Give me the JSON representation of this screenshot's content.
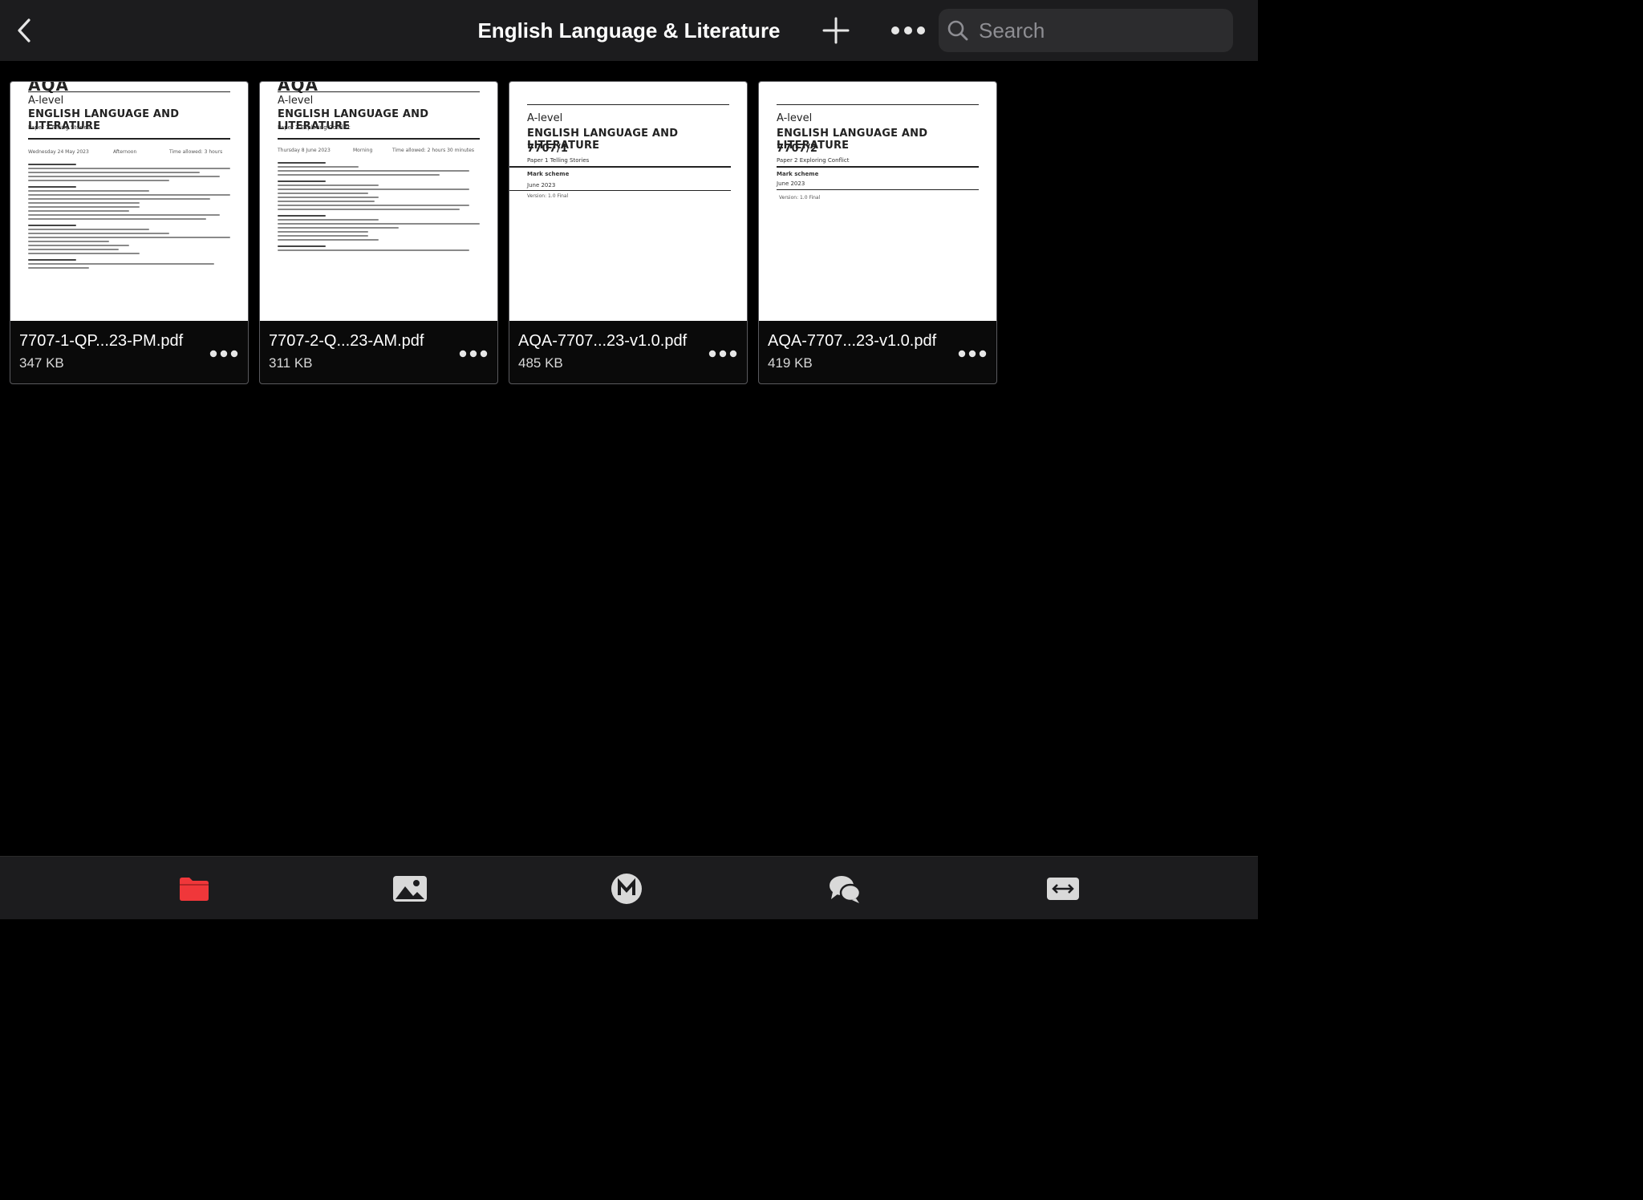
{
  "header": {
    "title": "English Language & Literature",
    "back_icon": "chevron-left-icon",
    "add_icon": "plus-icon",
    "more_icon": "ellipsis-icon",
    "search": {
      "placeholder": "Search",
      "value": "",
      "icon": "search-icon"
    }
  },
  "files": [
    {
      "name": "7707-1-QP...23-PM.pdf",
      "size": "347 KB",
      "thumb": {
        "logo": "AQA",
        "level": "A-level",
        "subject": "ENGLISH LANGUAGE AND LITERATURE",
        "paper": "Paper 1  Telling Stories",
        "date": "Wednesday 24 May 2023",
        "session": "Afternoon",
        "time": "Time allowed: 3 hours"
      }
    },
    {
      "name": "7707-2-Q...23-AM.pdf",
      "size": "311 KB",
      "thumb": {
        "logo": "AQA",
        "level": "A-level",
        "subject": "ENGLISH LANGUAGE AND LITERATURE",
        "paper": "Paper 2  Exploring Conflict",
        "date": "Thursday 8 June 2023",
        "session": "Morning",
        "time": "Time allowed: 2 hours 30 minutes"
      }
    },
    {
      "name": "AQA-7707...23-v1.0.pdf",
      "size": "485 KB",
      "thumb": {
        "level": "A-level",
        "subject": "ENGLISH LANGUAGE AND LITERATURE",
        "code": "7707/1",
        "paper": "Paper 1 Telling Stories",
        "kind": "Mark scheme",
        "date": "June 2023",
        "version": "Version: 1.0 Final"
      }
    },
    {
      "name": "AQA-7707...23-v1.0.pdf",
      "size": "419 KB",
      "thumb": {
        "level": "A-level",
        "subject": "ENGLISH LANGUAGE AND LITERATURE",
        "code": "7707/2",
        "paper": "Paper 2  Exploring Conflict",
        "kind": "Mark scheme",
        "date": "June 2023",
        "version": "Version: 1.0 Final"
      }
    }
  ],
  "tabs": [
    {
      "name": "files",
      "icon": "folder-icon",
      "active": true
    },
    {
      "name": "photos",
      "icon": "photo-icon",
      "active": false
    },
    {
      "name": "mega",
      "icon": "mega-logo-icon",
      "active": false
    },
    {
      "name": "chat",
      "icon": "chat-bubbles-icon",
      "active": false
    },
    {
      "name": "transfers",
      "icon": "transfer-arrows-icon",
      "active": false
    }
  ],
  "colors": {
    "accent": "#f0373a",
    "background": "#000000",
    "bar": "#1c1c1e",
    "icon": "#d9d9d9"
  }
}
